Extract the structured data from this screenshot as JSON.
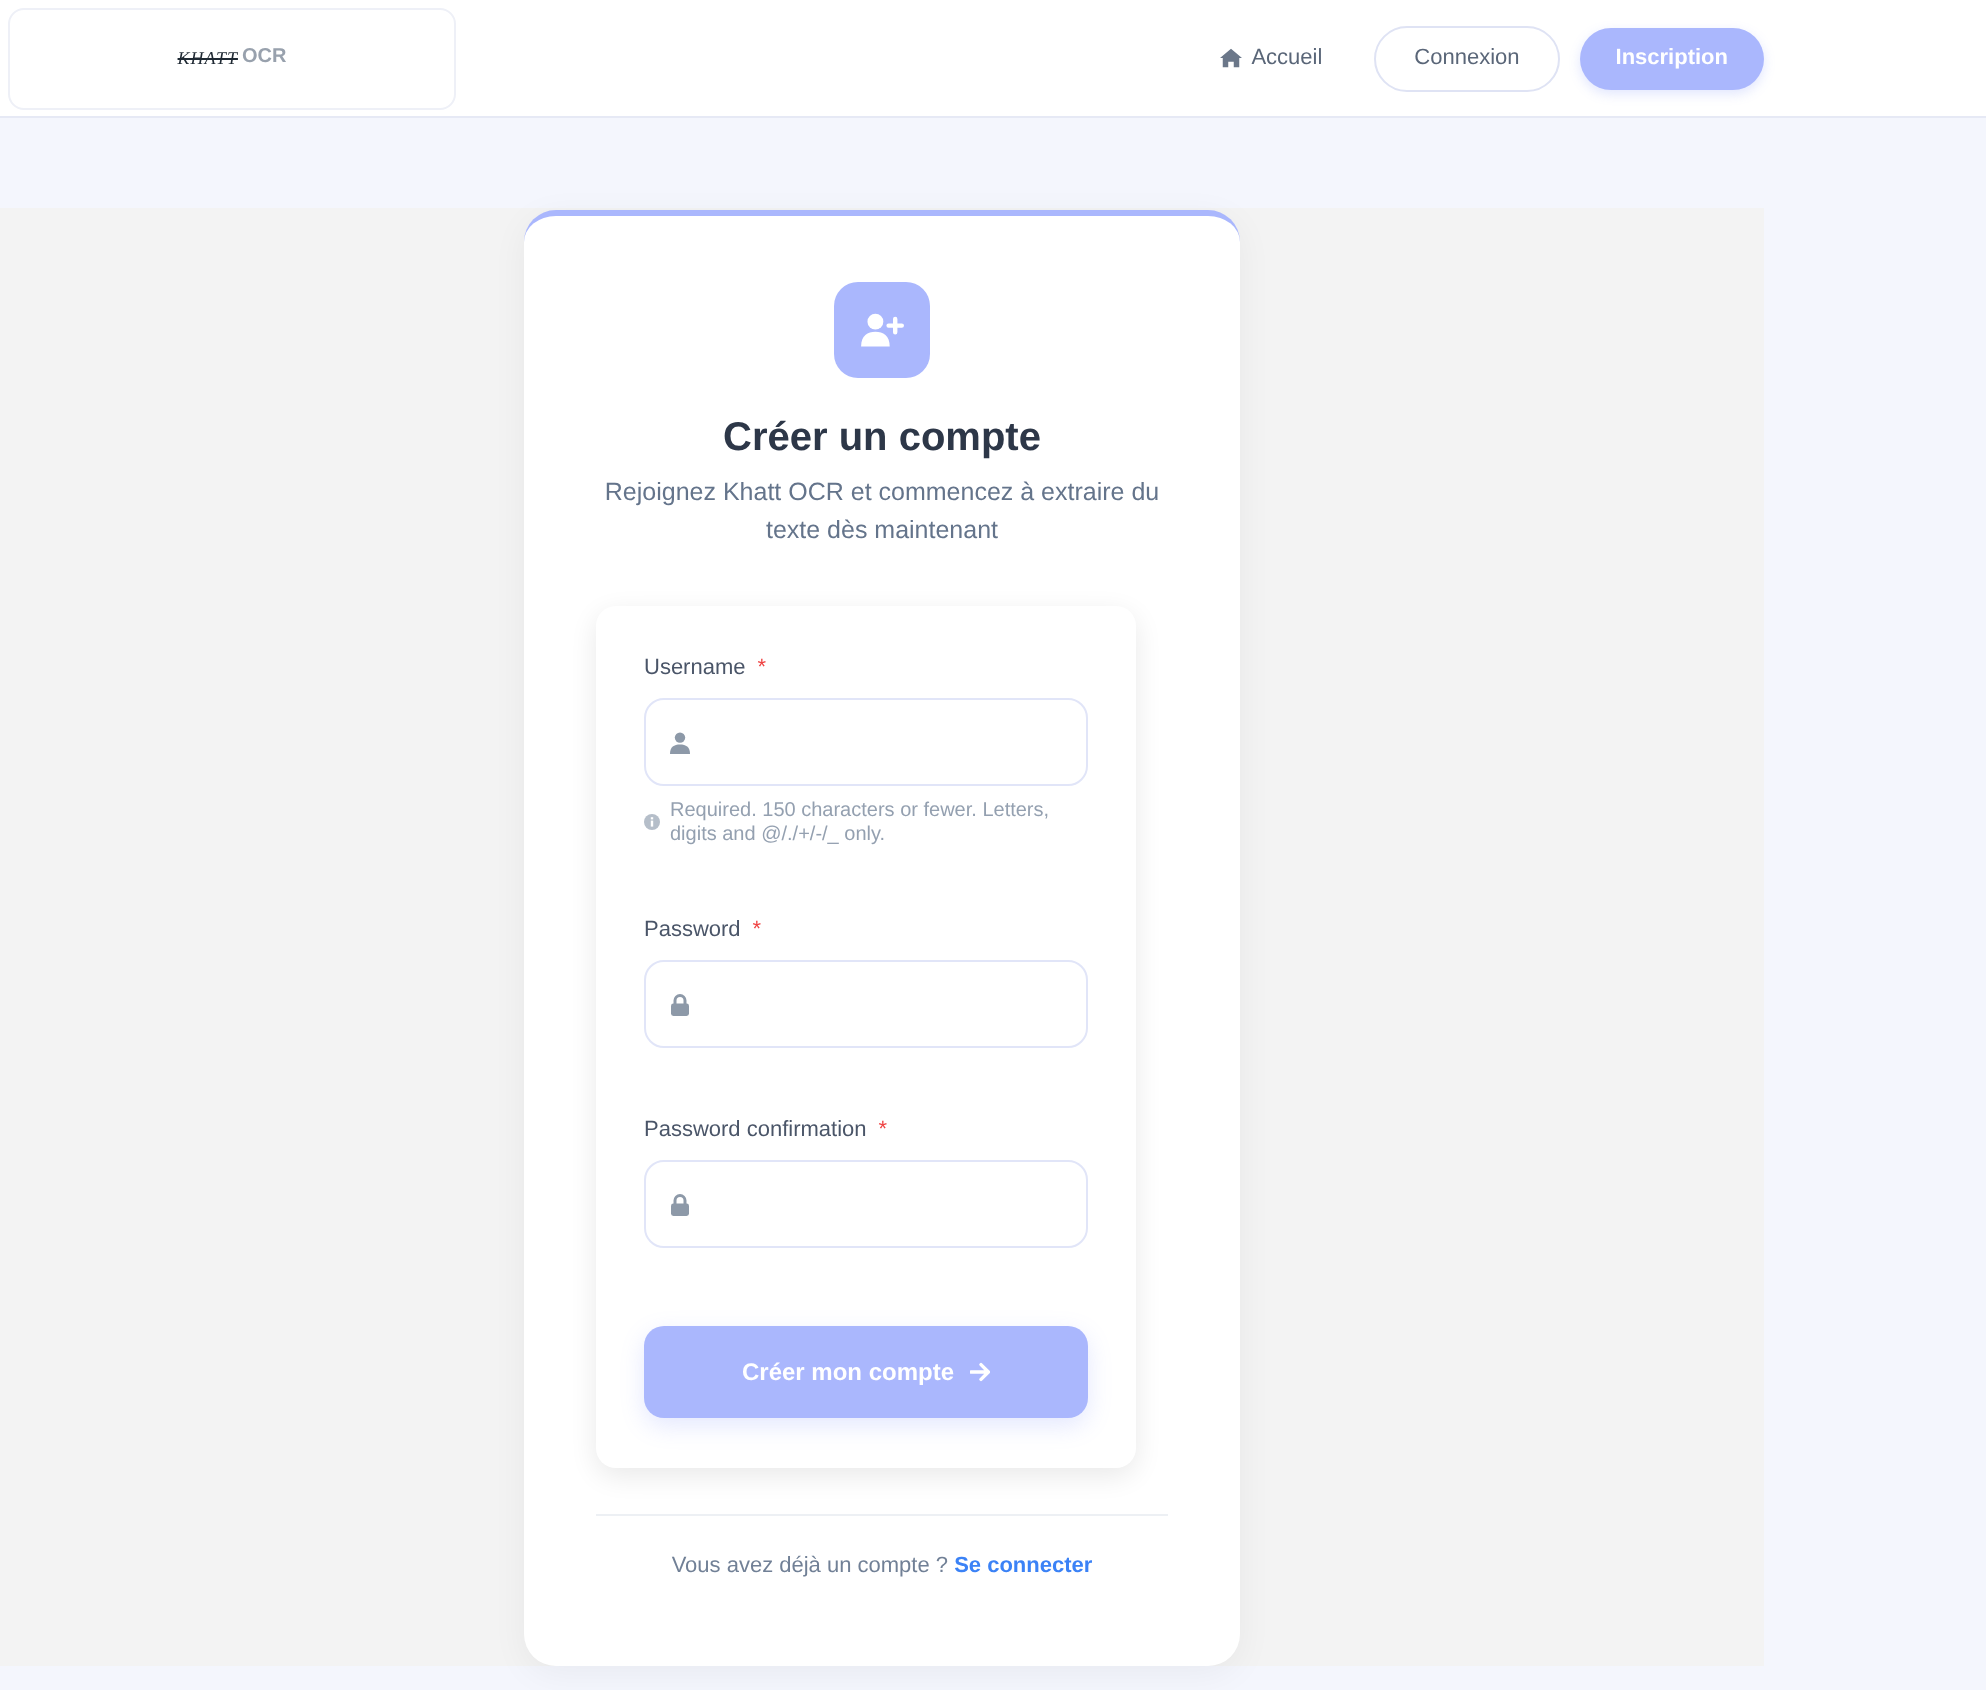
{
  "header": {
    "logo": {
      "script": "KHATT",
      "letters": "OCR"
    },
    "nav": [
      {
        "label": "Accueil",
        "kind": "link"
      },
      {
        "label": "Connexion",
        "kind": "outline"
      },
      {
        "label": "Inscription",
        "kind": "primary"
      }
    ]
  },
  "card": {
    "title": "Créer un compte",
    "subtitle": "Rejoignez Khatt OCR et commencez à extraire du texte dès maintenant",
    "fields": [
      {
        "label": "Username",
        "required_mark": "*",
        "kind": "username",
        "help": "Required. 150 characters or fewer. Letters, digits and @/./+/-/_ only."
      },
      {
        "label": "Password",
        "required_mark": "*",
        "kind": "password"
      },
      {
        "label": "Password confirmation",
        "required_mark": "*",
        "kind": "password"
      }
    ],
    "submit": "Créer mon compte",
    "footer": {
      "text": "Vous avez déjà un compte ?",
      "link": "Se connecter"
    }
  }
}
